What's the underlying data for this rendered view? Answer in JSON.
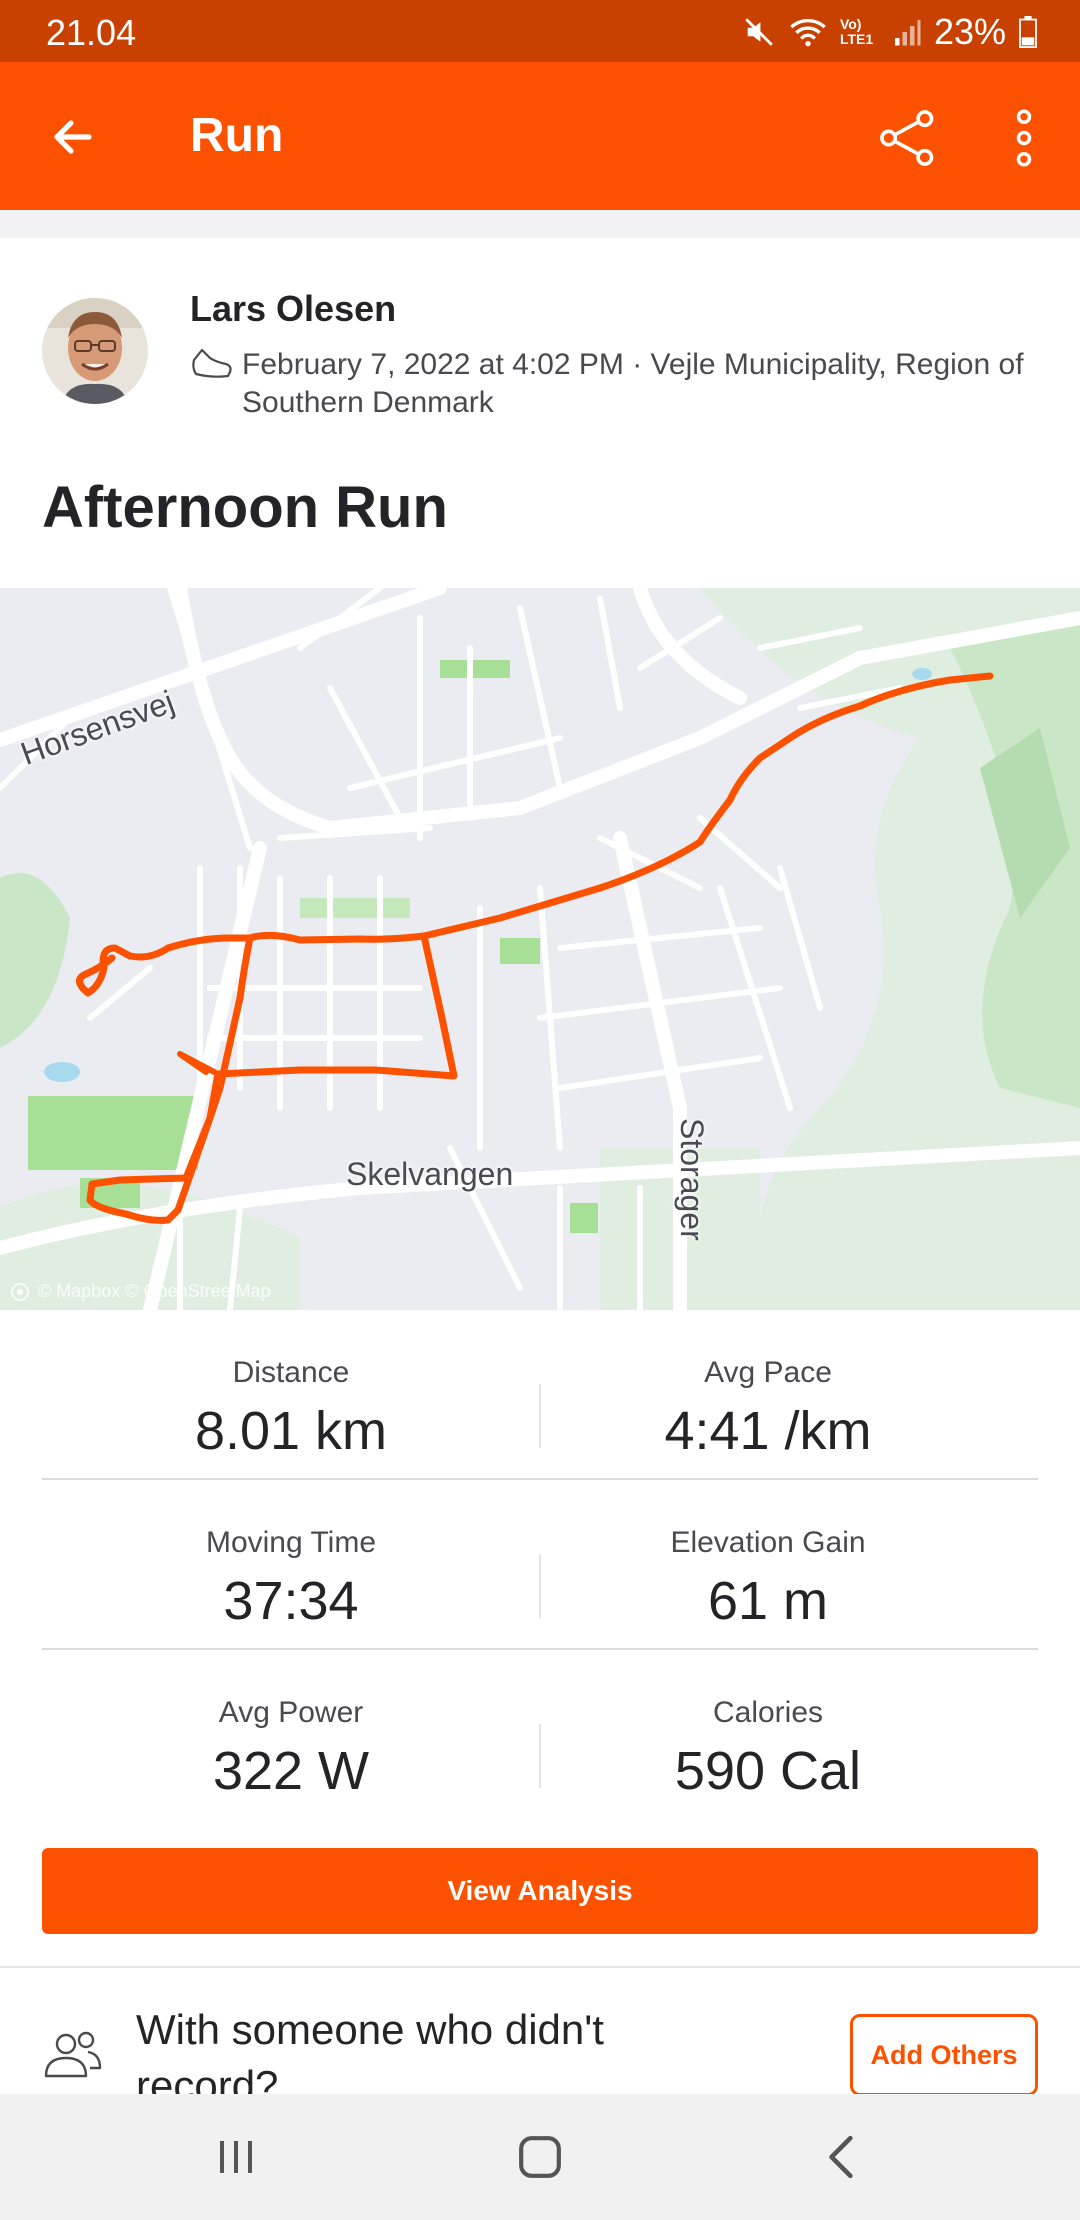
{
  "status_bar": {
    "time": "21.04",
    "battery": "23%",
    "network_label": "Vo) LTE1"
  },
  "app_bar": {
    "title": "Run"
  },
  "activity": {
    "athlete_name": "Lars Olesen",
    "date_location": "February 7, 2022 at 4:02 PM · Vejle Municipality, Region of Southern Denmark",
    "title": "Afternoon Run"
  },
  "map": {
    "attribution": "© Mapbox © OpenStreetMap",
    "labels": {
      "horsensvej": "Horsensvej",
      "skelvangen": "Skelvangen",
      "storager": "Storager"
    },
    "route_color": "#fc5200"
  },
  "stats": [
    {
      "label": "Distance",
      "value": "8.01 km"
    },
    {
      "label": "Avg Pace",
      "value": "4:41 /km"
    },
    {
      "label": "Moving Time",
      "value": "37:34"
    },
    {
      "label": "Elevation Gain",
      "value": "61 m"
    },
    {
      "label": "Avg Power",
      "value": "322 W"
    },
    {
      "label": "Calories",
      "value": "590 Cal"
    }
  ],
  "actions": {
    "view_analysis": "View Analysis",
    "with_someone": "With someone who didn't record?",
    "add_others": "Add Others"
  },
  "colors": {
    "brand": "#fc5200",
    "status_bar": "#c84100"
  },
  "icons": [
    "back-arrow-icon",
    "share-icon",
    "more-vert-icon",
    "shoe-icon",
    "people-icon",
    "recents-icon",
    "home-icon",
    "nav-back-icon"
  ]
}
